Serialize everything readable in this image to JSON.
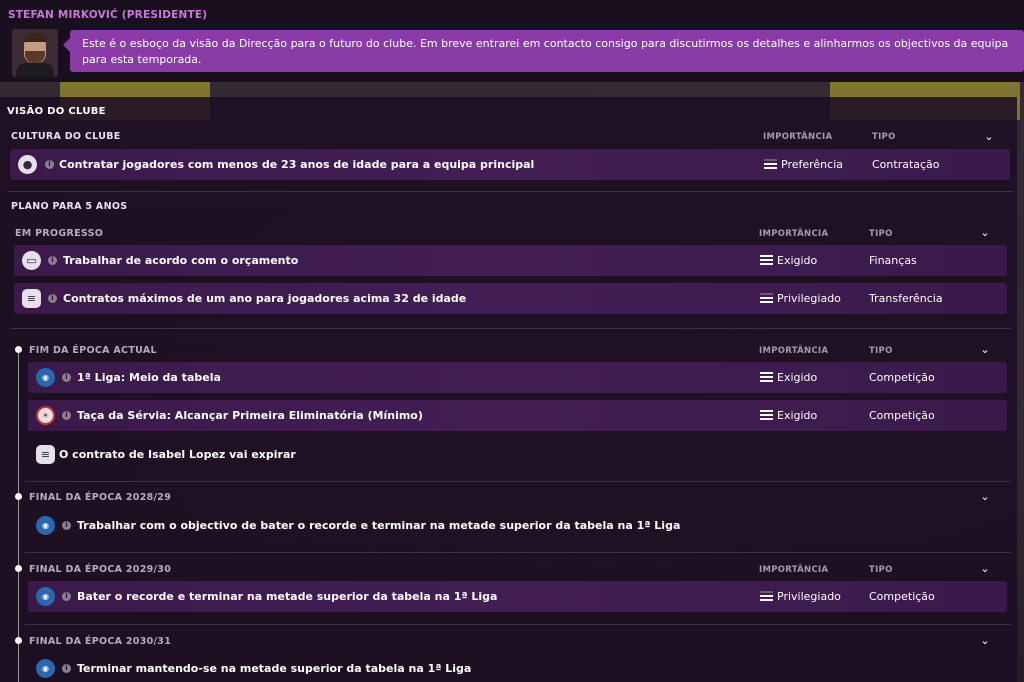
{
  "header": {
    "name": "STEFAN MIRKOVIĆ (PRESIDENTE)",
    "message": "Este é o esboço da visão da Direcção para o futuro do clube. Em breve entrarei em contacto consigo para discutirmos os detalhes e alinharmos os objectivos da equipa para esta temporada."
  },
  "panel": {
    "title": "VISÃO DO CLUBE"
  },
  "culture": {
    "title": "CULTURA DO CLUBE",
    "col_importance": "IMPORTÂNCIA",
    "col_type": "TIPO",
    "rows": [
      {
        "label": "Contratar jogadores com menos de 23 anos de idade para a equipa principal",
        "importance": "Preferência",
        "type": "Contratação",
        "icon": "person-icon"
      }
    ]
  },
  "plan": {
    "title": "PLANO PARA 5 ANOS",
    "in_progress": {
      "title": "EM PROGRESSO",
      "col_importance": "IMPORTÂNCIA",
      "col_type": "TIPO",
      "rows": [
        {
          "label": "Trabalhar de acordo com o orçamento",
          "importance": "Exigido",
          "type": "Finanças",
          "icon": "wallet-icon"
        },
        {
          "label": "Contratos máximos de um ano para jogadores acima 32 de idade",
          "importance": "Privilegiado",
          "type": "Transferência",
          "icon": "contract-icon"
        }
      ]
    },
    "end_current": {
      "title": "FIM DA ÉPOCA ACTUAL",
      "col_importance": "IMPORTÂNCIA",
      "col_type": "TIPO",
      "rows": [
        {
          "label": "1ª Liga: Meio da tabela",
          "importance": "Exigido",
          "type": "Competição",
          "icon": "league-logo-icon"
        },
        {
          "label": "Taça da Sérvia: Alcançar Primeira Eliminatória (Mínimo)",
          "importance": "Exigido",
          "type": "Competição",
          "icon": "cup-logo-icon"
        }
      ],
      "note": "O contrato de Isabel Lopez vai expirar"
    },
    "end_2829": {
      "title": "FINAL DA ÉPOCA 2028/29",
      "rows": [
        {
          "label": "Trabalhar com o objectivo de bater o recorde e terminar na metade superior da tabela na 1ª Liga",
          "icon": "league-logo-icon"
        }
      ]
    },
    "end_2930": {
      "title": "FINAL DA ÉPOCA 2029/30",
      "col_importance": "IMPORTÂNCIA",
      "col_type": "TIPO",
      "rows": [
        {
          "label": "Bater o recorde e terminar na metade superior da tabela na 1ª Liga",
          "importance": "Privilegiado",
          "type": "Competição",
          "icon": "league-logo-icon"
        }
      ]
    },
    "end_3031": {
      "title": "FINAL DA ÉPOCA 2030/31",
      "rows": [
        {
          "label": "Terminar mantendo-se na metade superior da tabela na 1ª Liga",
          "icon": "league-logo-icon"
        }
      ]
    }
  }
}
